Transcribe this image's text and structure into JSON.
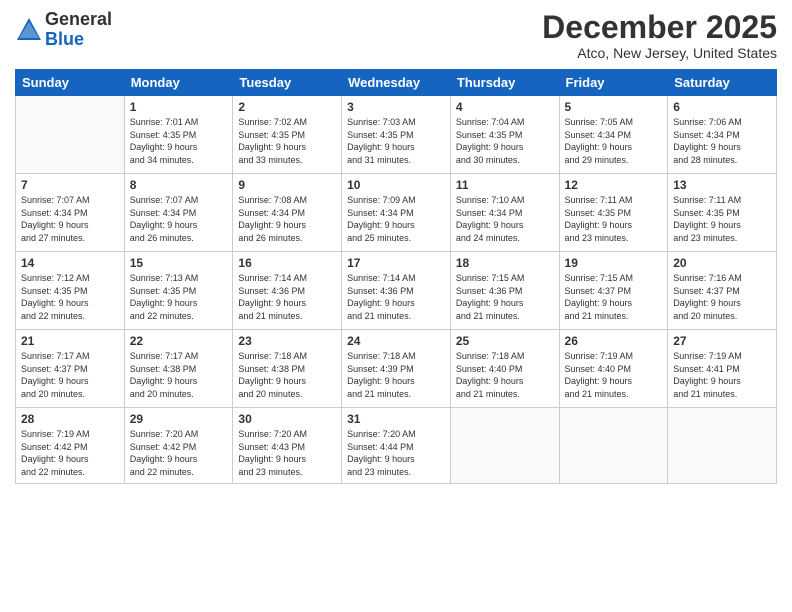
{
  "logo": {
    "general": "General",
    "blue": "Blue"
  },
  "title": "December 2025",
  "location": "Atco, New Jersey, United States",
  "days_of_week": [
    "Sunday",
    "Monday",
    "Tuesday",
    "Wednesday",
    "Thursday",
    "Friday",
    "Saturday"
  ],
  "weeks": [
    [
      {
        "day": "",
        "info": ""
      },
      {
        "day": "1",
        "info": "Sunrise: 7:01 AM\nSunset: 4:35 PM\nDaylight: 9 hours\nand 34 minutes."
      },
      {
        "day": "2",
        "info": "Sunrise: 7:02 AM\nSunset: 4:35 PM\nDaylight: 9 hours\nand 33 minutes."
      },
      {
        "day": "3",
        "info": "Sunrise: 7:03 AM\nSunset: 4:35 PM\nDaylight: 9 hours\nand 31 minutes."
      },
      {
        "day": "4",
        "info": "Sunrise: 7:04 AM\nSunset: 4:35 PM\nDaylight: 9 hours\nand 30 minutes."
      },
      {
        "day": "5",
        "info": "Sunrise: 7:05 AM\nSunset: 4:34 PM\nDaylight: 9 hours\nand 29 minutes."
      },
      {
        "day": "6",
        "info": "Sunrise: 7:06 AM\nSunset: 4:34 PM\nDaylight: 9 hours\nand 28 minutes."
      }
    ],
    [
      {
        "day": "7",
        "info": "Sunrise: 7:07 AM\nSunset: 4:34 PM\nDaylight: 9 hours\nand 27 minutes."
      },
      {
        "day": "8",
        "info": "Sunrise: 7:07 AM\nSunset: 4:34 PM\nDaylight: 9 hours\nand 26 minutes."
      },
      {
        "day": "9",
        "info": "Sunrise: 7:08 AM\nSunset: 4:34 PM\nDaylight: 9 hours\nand 26 minutes."
      },
      {
        "day": "10",
        "info": "Sunrise: 7:09 AM\nSunset: 4:34 PM\nDaylight: 9 hours\nand 25 minutes."
      },
      {
        "day": "11",
        "info": "Sunrise: 7:10 AM\nSunset: 4:34 PM\nDaylight: 9 hours\nand 24 minutes."
      },
      {
        "day": "12",
        "info": "Sunrise: 7:11 AM\nSunset: 4:35 PM\nDaylight: 9 hours\nand 23 minutes."
      },
      {
        "day": "13",
        "info": "Sunrise: 7:11 AM\nSunset: 4:35 PM\nDaylight: 9 hours\nand 23 minutes."
      }
    ],
    [
      {
        "day": "14",
        "info": "Sunrise: 7:12 AM\nSunset: 4:35 PM\nDaylight: 9 hours\nand 22 minutes."
      },
      {
        "day": "15",
        "info": "Sunrise: 7:13 AM\nSunset: 4:35 PM\nDaylight: 9 hours\nand 22 minutes."
      },
      {
        "day": "16",
        "info": "Sunrise: 7:14 AM\nSunset: 4:36 PM\nDaylight: 9 hours\nand 21 minutes."
      },
      {
        "day": "17",
        "info": "Sunrise: 7:14 AM\nSunset: 4:36 PM\nDaylight: 9 hours\nand 21 minutes."
      },
      {
        "day": "18",
        "info": "Sunrise: 7:15 AM\nSunset: 4:36 PM\nDaylight: 9 hours\nand 21 minutes."
      },
      {
        "day": "19",
        "info": "Sunrise: 7:15 AM\nSunset: 4:37 PM\nDaylight: 9 hours\nand 21 minutes."
      },
      {
        "day": "20",
        "info": "Sunrise: 7:16 AM\nSunset: 4:37 PM\nDaylight: 9 hours\nand 20 minutes."
      }
    ],
    [
      {
        "day": "21",
        "info": "Sunrise: 7:17 AM\nSunset: 4:37 PM\nDaylight: 9 hours\nand 20 minutes."
      },
      {
        "day": "22",
        "info": "Sunrise: 7:17 AM\nSunset: 4:38 PM\nDaylight: 9 hours\nand 20 minutes."
      },
      {
        "day": "23",
        "info": "Sunrise: 7:18 AM\nSunset: 4:38 PM\nDaylight: 9 hours\nand 20 minutes."
      },
      {
        "day": "24",
        "info": "Sunrise: 7:18 AM\nSunset: 4:39 PM\nDaylight: 9 hours\nand 21 minutes."
      },
      {
        "day": "25",
        "info": "Sunrise: 7:18 AM\nSunset: 4:40 PM\nDaylight: 9 hours\nand 21 minutes."
      },
      {
        "day": "26",
        "info": "Sunrise: 7:19 AM\nSunset: 4:40 PM\nDaylight: 9 hours\nand 21 minutes."
      },
      {
        "day": "27",
        "info": "Sunrise: 7:19 AM\nSunset: 4:41 PM\nDaylight: 9 hours\nand 21 minutes."
      }
    ],
    [
      {
        "day": "28",
        "info": "Sunrise: 7:19 AM\nSunset: 4:42 PM\nDaylight: 9 hours\nand 22 minutes."
      },
      {
        "day": "29",
        "info": "Sunrise: 7:20 AM\nSunset: 4:42 PM\nDaylight: 9 hours\nand 22 minutes."
      },
      {
        "day": "30",
        "info": "Sunrise: 7:20 AM\nSunset: 4:43 PM\nDaylight: 9 hours\nand 23 minutes."
      },
      {
        "day": "31",
        "info": "Sunrise: 7:20 AM\nSunset: 4:44 PM\nDaylight: 9 hours\nand 23 minutes."
      },
      {
        "day": "",
        "info": ""
      },
      {
        "day": "",
        "info": ""
      },
      {
        "day": "",
        "info": ""
      }
    ]
  ]
}
